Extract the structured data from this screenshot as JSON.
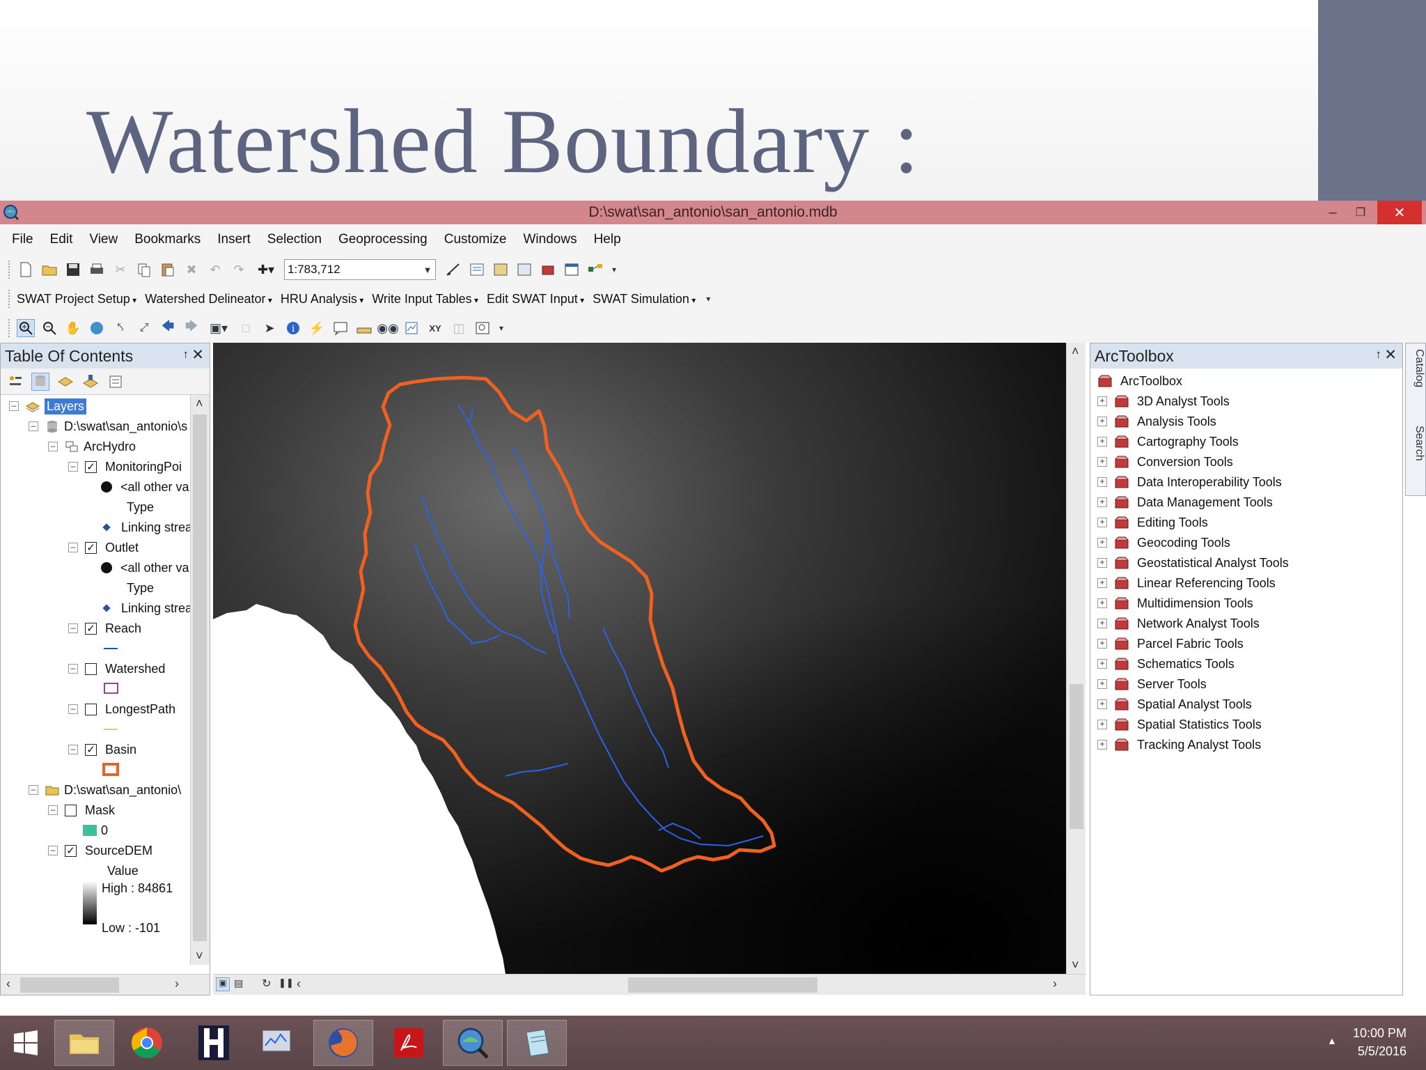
{
  "slide": {
    "title": "Watershed Boundary :"
  },
  "window": {
    "title": "D:\\swat\\san_antonio\\san_antonio.mdb",
    "minimize": "–",
    "restore": "❐",
    "close": "✕"
  },
  "menu": [
    "File",
    "Edit",
    "View",
    "Bookmarks",
    "Insert",
    "Selection",
    "Geoprocessing",
    "Customize",
    "Windows",
    "Help"
  ],
  "toolbar": {
    "scale": "1:783,712"
  },
  "swat_toolbar": [
    "SWAT Project Setup",
    "Watershed Delineator",
    "HRU Analysis",
    "Write Input Tables",
    "Edit SWAT Input",
    "SWAT Simulation"
  ],
  "toc": {
    "title": "Table Of Contents",
    "pin": "↑",
    "close": "✕",
    "layers_label": "Layers",
    "db1": "D:\\swat\\san_antonio\\s",
    "group": "ArcHydro",
    "monitoring": "MonitoringPoi",
    "all_other": "<all other va",
    "type": "Type",
    "linking": "Linking strea",
    "outlet": "Outlet",
    "reach": "Reach",
    "watershed": "Watershed",
    "longestpath": "LongestPath",
    "basin": "Basin",
    "db2": "D:\\swat\\san_antonio\\",
    "mask": "Mask",
    "mask_value": "0",
    "sourcedem": "SourceDEM",
    "value_label": "Value",
    "high": "High : 84861",
    "low": "Low : -101"
  },
  "toolbox": {
    "title": "ArcToolbox",
    "root": "ArcToolbox",
    "tools": [
      "3D Analyst Tools",
      "Analysis Tools",
      "Cartography Tools",
      "Conversion Tools",
      "Data Interoperability Tools",
      "Data Management Tools",
      "Editing Tools",
      "Geocoding Tools",
      "Geostatistical Analyst Tools",
      "Linear Referencing Tools",
      "Multidimension Tools",
      "Network Analyst Tools",
      "Parcel Fabric Tools",
      "Schematics Tools",
      "Server Tools",
      "Spatial Analyst Tools",
      "Spatial Statistics Tools",
      "Tracking Analyst Tools"
    ]
  },
  "side_tabs": {
    "catalog": "Catalog",
    "search": "Search"
  },
  "taskbar": {
    "time": "10:00 PM",
    "date": "5/5/2016"
  },
  "colors": {
    "titlebar": "#d3868c",
    "boundary": "#f0601e",
    "stream": "#2a62e8",
    "accent": "#6b7289"
  }
}
